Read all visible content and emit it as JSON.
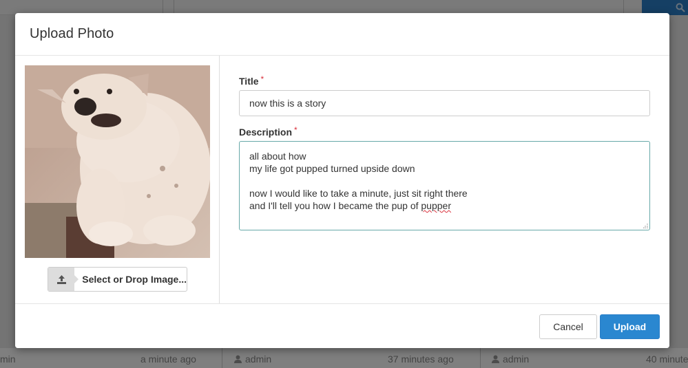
{
  "background": {
    "footer_cells": [
      {
        "text": "min"
      },
      {
        "text": "a minute ago"
      },
      {
        "text": "admin"
      },
      {
        "text": "37 minutes ago"
      },
      {
        "text": "admin"
      },
      {
        "text": "40 minute"
      }
    ]
  },
  "modal": {
    "title": "Upload Photo",
    "upload_button_label": "Select or Drop Image...",
    "title_field": {
      "label": "Title",
      "required_mark": "*",
      "value": "now this is a story"
    },
    "description_field": {
      "label": "Description",
      "required_mark": "*",
      "lines": [
        "all about how",
        "my life got pupped turned upside down",
        "",
        "now I would like to take a minute, just sit right there",
        "and I'll tell you how I became the pup of "
      ],
      "misspelled_word": "pupper"
    },
    "cancel_label": "Cancel",
    "upload_label": "Upload"
  },
  "colors": {
    "primary": "#2a87d0",
    "required": "#d9303b"
  },
  "icons": {
    "upload": "upload-icon",
    "search": "search-icon",
    "user": "user-icon"
  }
}
